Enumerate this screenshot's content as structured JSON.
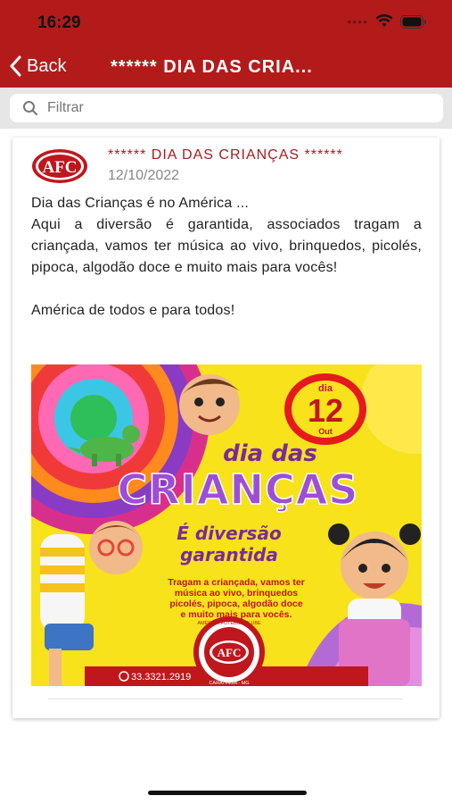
{
  "status_bar": {
    "time": "16:29",
    "icons": [
      "signal-dots-icon",
      "wifi-icon",
      "battery-icon"
    ]
  },
  "nav": {
    "back_label": "Back",
    "title": "****** DIA DAS CRIA..."
  },
  "search": {
    "placeholder": "Filtrar",
    "value": ""
  },
  "post": {
    "logo_text": "AFC",
    "title": "****** DIA DAS CRIANÇAS ******",
    "date": "12/10/2022",
    "body": [
      "Dia das Crianças é no América ...",
      "Aqui a diversão é garantida, associados tragam a criançada, vamos ter música ao vivo, brinquedos, picolés, pipoca, algodão doce e muito mais para vocês!",
      "América de todos e para todos!"
    ],
    "poster": {
      "badge_day_word": "dia",
      "badge_day": "12",
      "badge_month": "Out",
      "heading_small": "dia das",
      "heading_big": "CRIANÇAS",
      "tagline_line1": "É diversão",
      "tagline_line2": "garantida",
      "description": [
        "Tragam a criançada, vamos ter",
        "música ao vivo, brinquedos",
        "picolés, pipoca, algodão doce",
        "e muito mais para vocês."
      ],
      "phone": "33.3321.2919",
      "seal_text_top": "AMÉRICA FUTEBOL CLUBE",
      "seal_text_bottom": "CARATINGA - MG",
      "seal_center": "AFC"
    }
  },
  "colors": {
    "brand_red": "#b31b1b",
    "title_red": "#a81c1c",
    "poster_yellow": "#f7e21b",
    "poster_pink": "#d92f8c",
    "poster_purple": "#8a3bc4"
  }
}
